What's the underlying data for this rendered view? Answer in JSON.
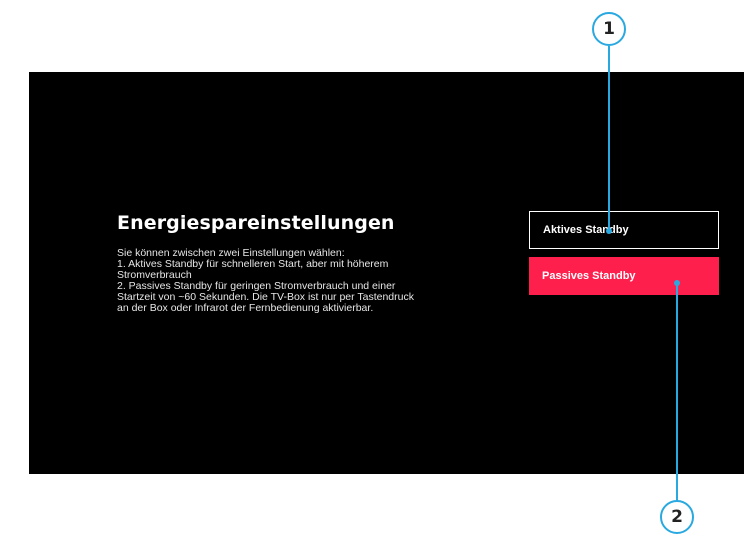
{
  "screen": {
    "title": "Energiespareinstellungen",
    "description_lines": [
      "Sie können zwischen zwei Einstellungen wählen:",
      "1. Aktives Standby für schnelleren Start, aber mit höherem",
      "Stromverbrauch",
      "2. Passives Standby für geringen Stromverbrauch und einer",
      "Startzeit von ~60 Sekunden. Die TV-Box ist nur per Tastendruck",
      "an der Box oder Infrarot der Fernbedienung aktivierbar."
    ]
  },
  "options": [
    {
      "label": "Aktives Standby",
      "state": "outlined"
    },
    {
      "label": "Passives Standby",
      "state": "selected",
      "color": "#ff1f4d"
    }
  ],
  "callouts": [
    "1",
    "2"
  ],
  "colors": {
    "callout": "#2aa9e0",
    "accent": "#ff1f4d",
    "background": "#000000"
  }
}
